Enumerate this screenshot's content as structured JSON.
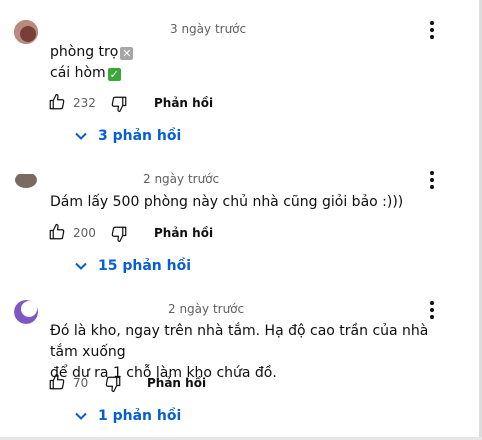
{
  "comments": [
    {
      "time": "3 ngày trước",
      "lines": [
        "phòng trọ",
        "cái hòm"
      ],
      "line_marks": [
        "cross-mark-icon",
        "check-mark-icon"
      ],
      "likes": "232",
      "reply_label": "Phản hồi",
      "replies_label": "3 phản hồi",
      "avatar_color": "#8a5a55"
    },
    {
      "time": "2 ngày trước",
      "lines": [
        "Dám lấy 500 phòng này chủ nhà cũng giỏi bảo :)))"
      ],
      "likes": "200",
      "reply_label": "Phản hồi",
      "replies_label": "15 phản hồi",
      "avatar_color": "#6b5a52"
    },
    {
      "time": "2 ngày trước",
      "lines": [
        "Đó là kho, ngay trên nhà tắm. Hạ độ cao trần của nhà tắm xuống",
        "để dư ra 1 chỗ làm kho chứa đồ."
      ],
      "likes": "70",
      "reply_label": "Phản hồi",
      "replies_label": "1 phản hồi",
      "avatar_color": "#7e57c2"
    }
  ],
  "colors": {
    "link_blue": "#065fd4",
    "meta_gray": "#606060",
    "text": "#0f0f0f"
  }
}
